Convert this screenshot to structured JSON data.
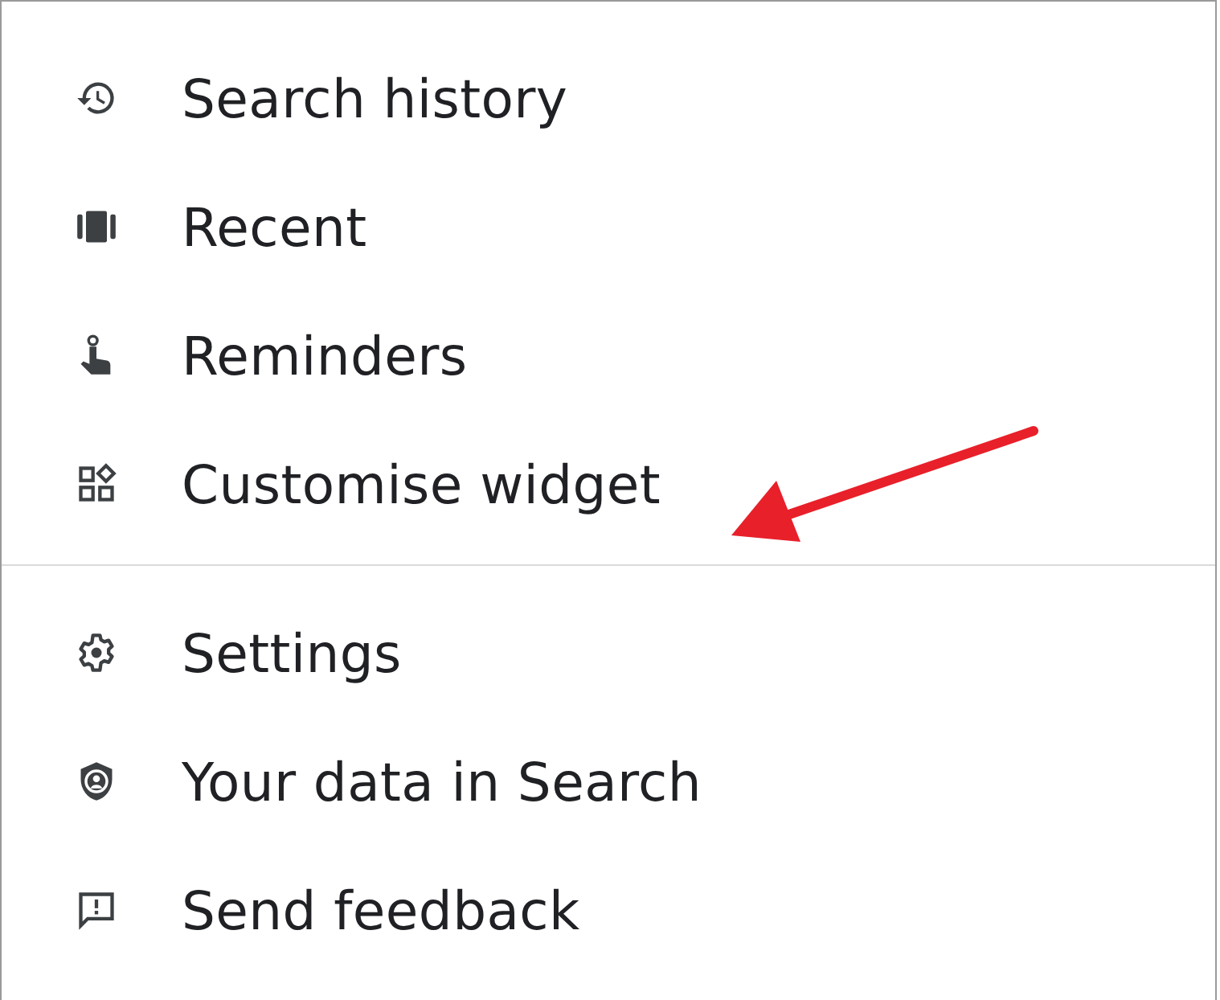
{
  "menu": {
    "sections": [
      {
        "items": [
          {
            "kind": "history",
            "label": "Search history"
          },
          {
            "kind": "recent",
            "label": "Recent"
          },
          {
            "kind": "reminder",
            "label": "Reminders"
          },
          {
            "kind": "widget",
            "label": "Customise widget"
          }
        ]
      },
      {
        "items": [
          {
            "kind": "settings",
            "label": "Settings"
          },
          {
            "kind": "privacy",
            "label": "Your data in Search"
          },
          {
            "kind": "feedback",
            "label": "Send feedback"
          }
        ]
      }
    ]
  }
}
